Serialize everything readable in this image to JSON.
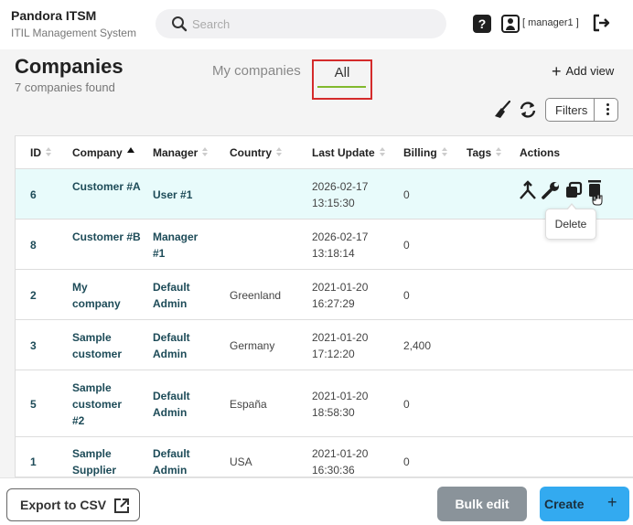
{
  "app": {
    "name": "Pandora ITSM",
    "subtitle": "ITIL Management System"
  },
  "search": {
    "placeholder": "Search"
  },
  "user": {
    "label": "[ manager1 ]"
  },
  "page": {
    "title": "Companies",
    "found": "7 companies found"
  },
  "tabs": [
    {
      "label": "My companies",
      "active": false
    },
    {
      "label": "All",
      "active": true
    }
  ],
  "toolbar": {
    "add_view": "Add view",
    "filters": "Filters"
  },
  "table": {
    "columns": [
      "ID",
      "Company",
      "Manager",
      "Country",
      "Last Update",
      "Billing",
      "Tags",
      "Actions"
    ],
    "sorted_column": "Company",
    "rows": [
      {
        "id": "6",
        "company": "Customer #A",
        "manager": "User #1",
        "country": "",
        "last_update": "2026-02-17 13:15:30",
        "billing": "0",
        "tags": ""
      },
      {
        "id": "8",
        "company": "Customer #B",
        "manager": "Manager #1",
        "country": "",
        "last_update": "2026-02-17 13:18:14",
        "billing": "0",
        "tags": ""
      },
      {
        "id": "2",
        "company": "My company",
        "manager": "Default Admin",
        "country": "Greenland",
        "last_update": "2021-01-20 16:27:29",
        "billing": "0",
        "tags": ""
      },
      {
        "id": "3",
        "company": "Sample customer",
        "manager": "Default Admin",
        "country": "Germany",
        "last_update": "2021-01-20 17:12:20",
        "billing": "2,400",
        "tags": ""
      },
      {
        "id": "5",
        "company": "Sample customer #2",
        "manager": "Default Admin",
        "country": "España",
        "last_update": "2021-01-20 18:58:30",
        "billing": "0",
        "tags": ""
      },
      {
        "id": "1",
        "company": "Sample Supplier",
        "manager": "Default Admin",
        "country": "USA",
        "last_update": "2021-01-20 16:30:36",
        "billing": "0",
        "tags": ""
      }
    ],
    "tooltip": "Delete"
  },
  "footer": {
    "export": "Export to CSV",
    "bulk_edit": "Bulk edit",
    "create": "Create",
    "create_plus": "+"
  },
  "colors": {
    "accent_green": "#82b92e",
    "link_teal": "#1d4b58",
    "create_blue": "#33aaf0",
    "bulk_gray": "#8a939a",
    "highlight_row": "#e8fbfb"
  }
}
